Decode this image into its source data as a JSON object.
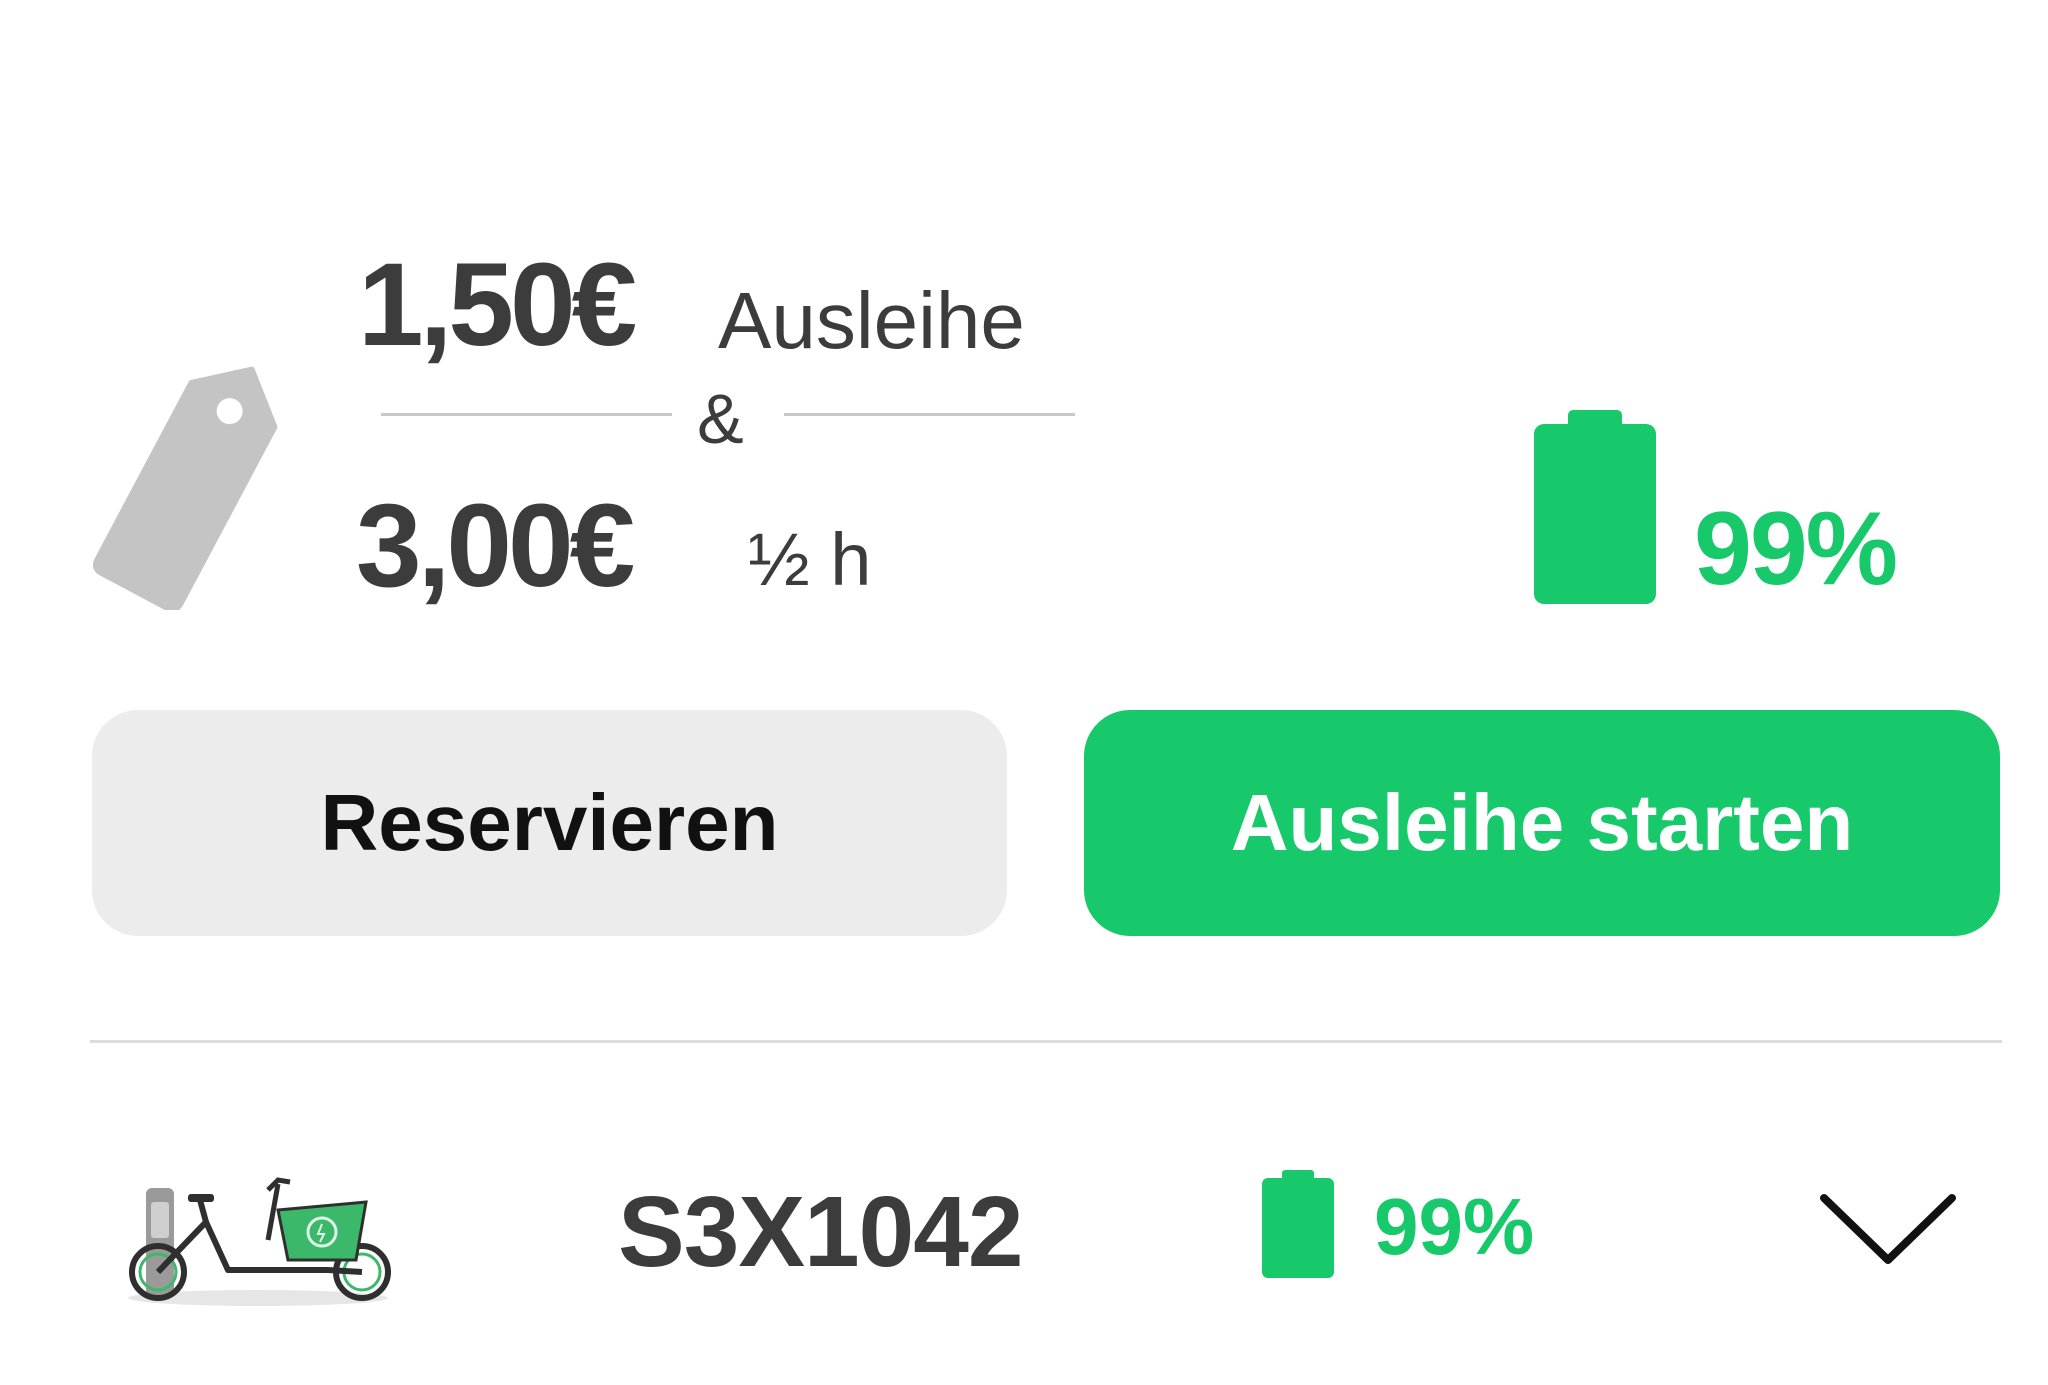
{
  "pricing": {
    "price_1": "1,50€",
    "unit_1": "Ausleihe",
    "connector": "&",
    "price_2": "3,00€",
    "unit_2": "½ h"
  },
  "battery": {
    "percent_text": "99%",
    "level": 0.99
  },
  "actions": {
    "reserve_label": "Reservieren",
    "start_label": "Ausleihe starten"
  },
  "bike": {
    "id": "S3X1042",
    "battery_text": "99%"
  },
  "colors": {
    "accent": "#17c96a",
    "text_dark": "#3c3c3c",
    "button_neutral": "#ececec",
    "tag_gray": "#c4c4c4"
  },
  "icons": {
    "tag": "price-tag-icon",
    "battery": "battery-icon",
    "bike": "cargo-bike-icon",
    "expand": "chevron-down-icon"
  }
}
